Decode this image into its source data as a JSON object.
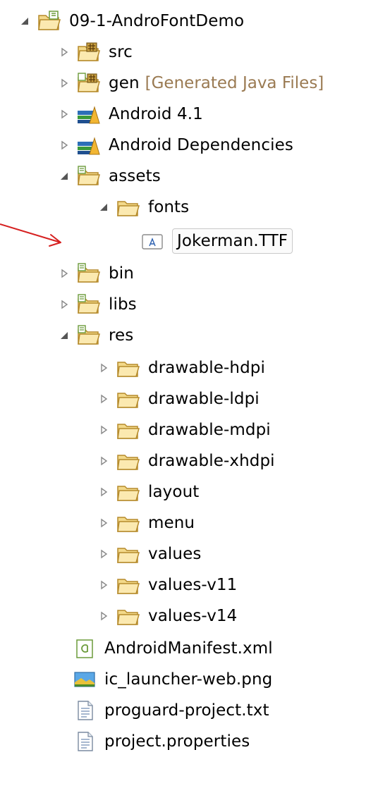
{
  "package_explorer": {
    "project": {
      "label": "09-1-AndroFontDemo"
    },
    "src": {
      "label": "src"
    },
    "gen": {
      "label": "gen",
      "decoration": "[Generated Java Files]"
    },
    "android_lib": {
      "label": "Android 4.1"
    },
    "android_deps": {
      "label": "Android Dependencies"
    },
    "assets": {
      "label": "assets"
    },
    "fonts": {
      "label": "fonts"
    },
    "font_file": {
      "label": "Jokerman.TTF"
    },
    "bin": {
      "label": "bin"
    },
    "libs": {
      "label": "libs"
    },
    "res": {
      "label": "res"
    },
    "res_children": [
      {
        "label": "drawable-hdpi"
      },
      {
        "label": "drawable-ldpi"
      },
      {
        "label": "drawable-mdpi"
      },
      {
        "label": "drawable-xhdpi"
      },
      {
        "label": "layout"
      },
      {
        "label": "menu"
      },
      {
        "label": "values"
      },
      {
        "label": "values-v11"
      },
      {
        "label": "values-v14"
      }
    ],
    "files": [
      {
        "label": "AndroidManifest.xml",
        "icon": "android-manifest-icon"
      },
      {
        "label": "ic_launcher-web.png",
        "icon": "image-file-icon"
      },
      {
        "label": "proguard-project.txt",
        "icon": "text-file-icon"
      },
      {
        "label": "project.properties",
        "icon": "text-file-icon"
      }
    ]
  },
  "colors": {
    "folder_fill": "#f3d98a",
    "folder_stroke": "#b58a2b",
    "source_marker": "#6b9b3a",
    "annotation_arrow": "#d62020"
  }
}
